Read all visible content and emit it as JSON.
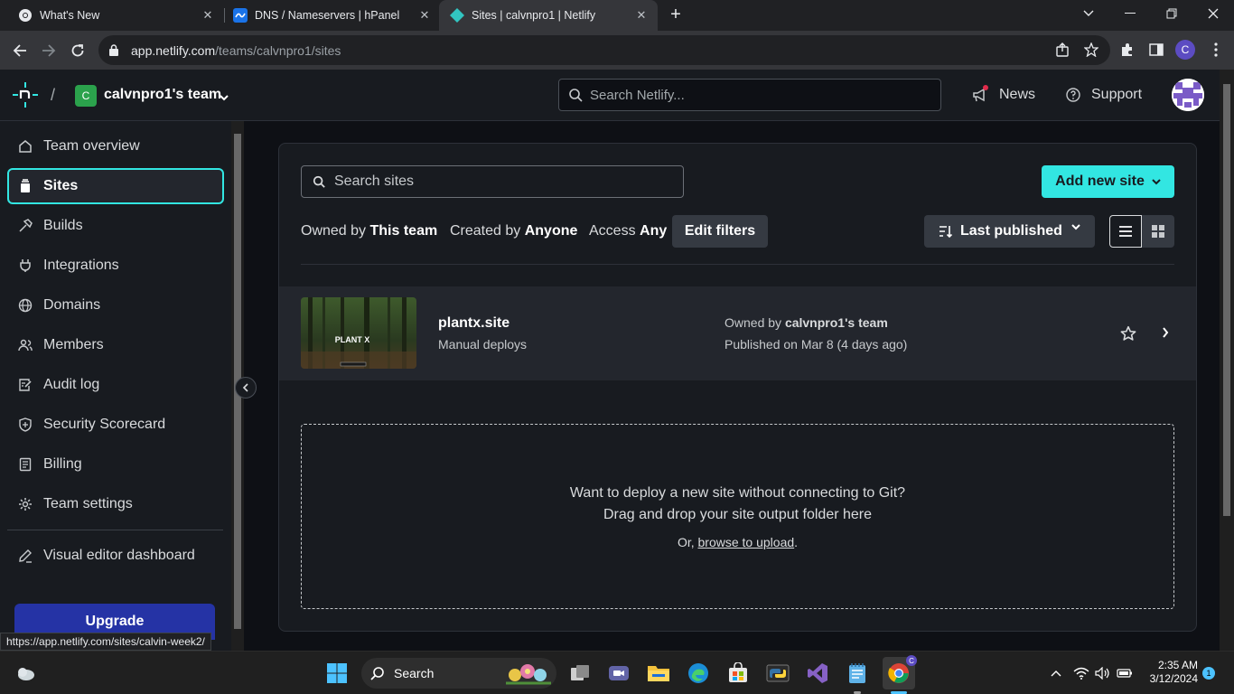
{
  "browser": {
    "tabs": [
      {
        "title": "What's New"
      },
      {
        "title": "DNS / Nameservers | hPanel"
      },
      {
        "title": "Sites | calvnpro1 | Netlify"
      }
    ],
    "url_host": "app.netlify.com",
    "url_path": "/teams/calvnpro1/sites",
    "profile_initial": "C",
    "status_url": "https://app.netlify.com/sites/calvin-week2/"
  },
  "header": {
    "team_initial": "C",
    "team_name": "calvnpro1's team",
    "search_placeholder": "Search Netlify...",
    "news_label": "News",
    "support_label": "Support"
  },
  "sidebar": {
    "items": [
      {
        "label": "Team overview",
        "icon": "home-icon"
      },
      {
        "label": "Sites",
        "icon": "layers-icon"
      },
      {
        "label": "Builds",
        "icon": "hammer-icon"
      },
      {
        "label": "Integrations",
        "icon": "plug-icon"
      },
      {
        "label": "Domains",
        "icon": "globe-icon"
      },
      {
        "label": "Members",
        "icon": "people-icon"
      },
      {
        "label": "Audit log",
        "icon": "log-icon"
      },
      {
        "label": "Security Scorecard",
        "icon": "shield-icon"
      },
      {
        "label": "Billing",
        "icon": "receipt-icon"
      },
      {
        "label": "Team settings",
        "icon": "gear-icon"
      }
    ],
    "visual_editor_label": "Visual editor dashboard",
    "upgrade_label": "Upgrade"
  },
  "main": {
    "search_placeholder": "Search sites",
    "add_site_label": "Add new site",
    "filters": {
      "owned_prefix": "Owned by",
      "owned_value": "This team",
      "created_prefix": "Created by",
      "created_value": "Anyone",
      "access_prefix": "Access",
      "access_value": "Any"
    },
    "edit_filters_label": "Edit filters",
    "sort_label": "Last published",
    "sites": [
      {
        "name": "plantx.site",
        "deploy_type": "Manual deploys",
        "owned_prefix": "Owned by",
        "owner": "calvnpro1's team",
        "published": "Published on Mar 8 (4 days ago)",
        "thumbnail_text": "PLANT X"
      }
    ],
    "dropzone": {
      "line1": "Want to deploy a new site without connecting to Git?",
      "line2": "Drag and drop your site output folder here",
      "or_prefix": "Or,",
      "browse_label": "browse to upload",
      "suffix": "."
    }
  },
  "taskbar": {
    "search_label": "Search",
    "time": "2:35 AM",
    "date": "3/12/2024",
    "notification_count": "1"
  },
  "colors": {
    "accent": "#32e6e2",
    "upgrade": "#2533a5",
    "background": "#0e1015",
    "panel": "#181b20"
  }
}
